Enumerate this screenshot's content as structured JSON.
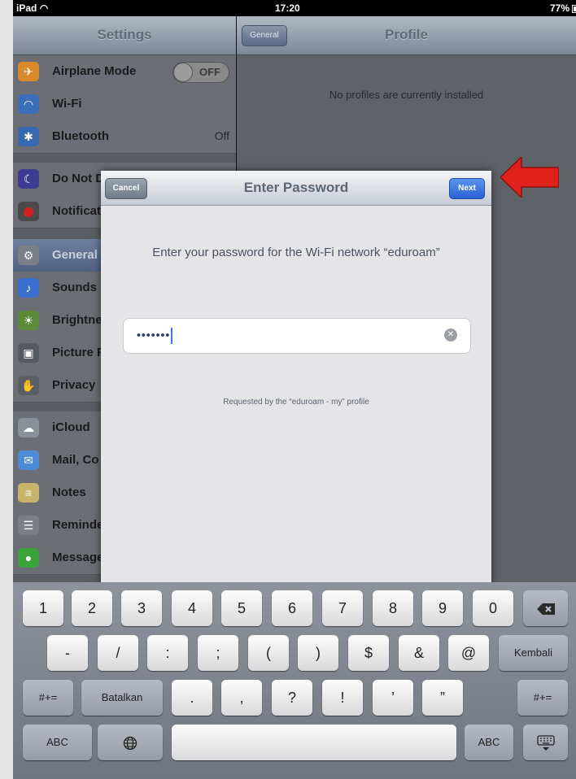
{
  "status": {
    "left": "iPad",
    "time": "17:20",
    "battery": "77%"
  },
  "settings": {
    "title": "Settings",
    "items": [
      {
        "label": "Airplane Mode",
        "toggle": "OFF",
        "icon": "airplane-icon"
      },
      {
        "label": "Wi-Fi",
        "icon": "wifi-icon"
      },
      {
        "label": "Bluetooth",
        "value": "Off",
        "icon": "bluetooth-icon"
      },
      {
        "label": "Do Not D",
        "icon": "moon-icon"
      },
      {
        "label": "Notificat",
        "icon": "notifications-icon"
      },
      {
        "label": "General",
        "icon": "gear-icon",
        "selected": true
      },
      {
        "label": "Sounds",
        "icon": "speaker-icon"
      },
      {
        "label": "Brightne",
        "icon": "brightness-icon"
      },
      {
        "label": "Picture F",
        "icon": "picture-frame-icon"
      },
      {
        "label": "Privacy",
        "icon": "hand-icon"
      },
      {
        "label": "iCloud",
        "icon": "cloud-icon"
      },
      {
        "label": "Mail, Co",
        "icon": "mail-icon"
      },
      {
        "label": "Notes",
        "icon": "notes-icon"
      },
      {
        "label": "Reminde",
        "icon": "reminders-icon"
      },
      {
        "label": "Message",
        "icon": "messages-icon"
      }
    ]
  },
  "profile": {
    "back": "General",
    "title": "Profile",
    "empty_text": "No profiles are currently installed"
  },
  "dialog": {
    "title": "Enter Password",
    "cancel": "Cancel",
    "next": "Next",
    "prompt": "Enter your password for the Wi-Fi network “eduroam”",
    "password_dots": "•••••••",
    "requested_by": "Requested by the “eduroam - my” profile"
  },
  "keyboard": {
    "row1": [
      "1",
      "2",
      "3",
      "4",
      "5",
      "6",
      "7",
      "8",
      "9",
      "0"
    ],
    "row2": [
      "-",
      "/",
      ":",
      ";",
      "(",
      ")",
      "$",
      "&",
      "@"
    ],
    "return_label": "Kembali",
    "row3_left": "#+=",
    "undo_label": "Batalkan",
    "row3": [
      ".",
      ",",
      "?",
      "!",
      "’",
      "”"
    ],
    "row3_right": "#+=",
    "abc_left": "ABC",
    "abc_right": "ABC"
  },
  "colors": {
    "accent": "#2a62d3",
    "arrow": "#e0201a"
  }
}
